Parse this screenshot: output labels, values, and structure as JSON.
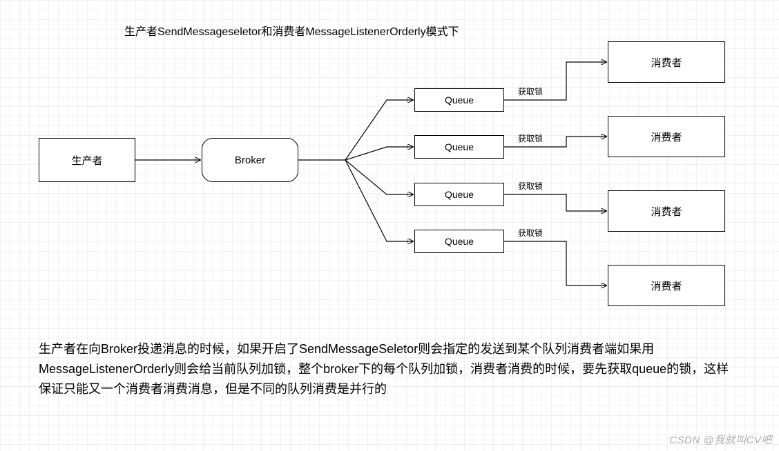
{
  "title": "生产者SendMessageseletor和消费者MessageListenerOrderly模式下",
  "nodes": {
    "producer": "生产者",
    "broker": "Broker",
    "queue1": "Queue",
    "queue2": "Queue",
    "queue3": "Queue",
    "queue4": "Queue",
    "consumer1": "消费者",
    "consumer2": "消费者",
    "consumer3": "消费者",
    "consumer4": "消费者"
  },
  "edge_labels": {
    "lock1": "获取锁",
    "lock2": "获取锁",
    "lock3": "获取锁",
    "lock4": "获取锁"
  },
  "explanation": "生产者在向Broker投递消息的时候，如果开启了SendMessageSeletor则会指定的发送到某个队列消费者端如果用MessageListenerOrderly则会给当前队列加锁，整个broker下的每个队列加锁，消费者消费的时候，要先获取queue的锁，这样保证只能又一个消费者消费消息，但是不同的队列消费是并行的",
  "watermark": "CSDN @我就叫CV吧"
}
